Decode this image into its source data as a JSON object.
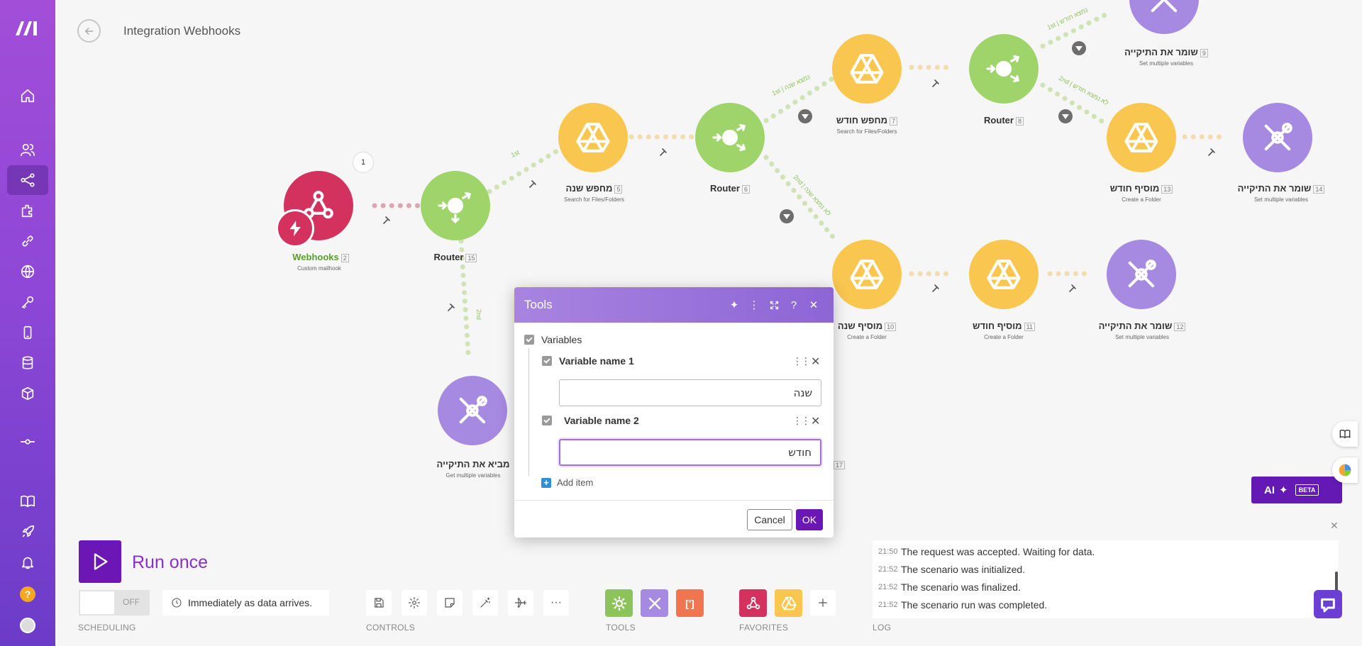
{
  "header": {
    "title": "Integration Webhooks"
  },
  "sidebar": {
    "items": [
      {
        "name": "home-icon"
      },
      {
        "name": "team-icon"
      },
      {
        "name": "scenarios-icon"
      },
      {
        "name": "templates-icon"
      },
      {
        "name": "connections-icon"
      },
      {
        "name": "webhooks-icon"
      },
      {
        "name": "keys-icon"
      },
      {
        "name": "devices-icon"
      },
      {
        "name": "datastores-icon"
      },
      {
        "name": "datastructures-icon"
      },
      {
        "name": "flow-icon"
      },
      {
        "name": "docs-icon"
      },
      {
        "name": "launch-icon"
      },
      {
        "name": "notifications-icon"
      }
    ],
    "help_label": "?"
  },
  "nodes": {
    "webhooks": {
      "title": "Webhooks",
      "num": "2",
      "sub": "Custom mailhook",
      "count": "1"
    },
    "router15": {
      "title": "Router",
      "num": "15"
    },
    "search_year": {
      "title": "מחפש שנה",
      "num": "5",
      "sub": "Search for Files/Folders"
    },
    "router6": {
      "title": "Router",
      "num": "6"
    },
    "search_month": {
      "title": "מחפש חודש",
      "num": "7",
      "sub": "Search for Files/Folders"
    },
    "router8": {
      "title": "Router",
      "num": "8"
    },
    "keeper9": {
      "title": "שומר את התיקייה",
      "num": "9",
      "sub": "Set multiple variables"
    },
    "add_month13": {
      "title": "מוסיף חודש",
      "num": "13",
      "sub": "Create a Folder"
    },
    "keeper14": {
      "title": "שומר את התיקייה",
      "num": "14",
      "sub": "Set multiple variables"
    },
    "add_year10": {
      "title": "מוסיף שנה",
      "num": "10",
      "sub": "Create a Folder"
    },
    "add_month11": {
      "title": "מוסיף חודש",
      "num": "11",
      "sub": "Create a Folder"
    },
    "keeper12": {
      "title": "שומר את התיקייה",
      "num": "12",
      "sub": "Set multiple variables"
    },
    "getter": {
      "title": "מביא את התיקייה",
      "sub": "Get multiple variables"
    },
    "hidden_num": "17"
  },
  "route_labels": {
    "r1": "1st",
    "r2": "2nd",
    "r6_1": "1st | נמצא שנה",
    "r6_2": "2nd | לא נמצא שנה",
    "r8_1": "1st | נמצא חודש",
    "r8_2": "2nd | לא נמצא חודש"
  },
  "modal": {
    "title": "Tools",
    "section": "Variables",
    "var1_label": "Variable name 1",
    "var1_value": "שנה",
    "var2_label": "Variable name 2",
    "var2_value": "חודש",
    "add_item": "Add item",
    "cancel": "Cancel",
    "ok": "OK"
  },
  "toolbar": {
    "run_label": "Run once",
    "toggle_text": "OFF",
    "schedule_text": "Immediately as data arrives.",
    "scheduling_label": "SCHEDULING",
    "controls_label": "CONTROLS",
    "tools_label": "TOOLS",
    "favorites_label": "FAVORITES",
    "log_label": "LOG",
    "more_label": "···",
    "brackets_label": "[']"
  },
  "log": [
    {
      "time": "21:50",
      "text": "The request was accepted. Waiting for data."
    },
    {
      "time": "21:52",
      "text": "The scenario was initialized."
    },
    {
      "time": "21:52",
      "text": "The scenario was finalized."
    },
    {
      "time": "21:52",
      "text": "The scenario run was completed."
    }
  ],
  "ai": {
    "label": "AI",
    "badge": "BETA"
  },
  "colors": {
    "sidebar": "#8e47d6",
    "webhook": "#d4325e",
    "router": "#9fd46a",
    "drive": "#f9c74f",
    "tools": "#a689e0",
    "accent": "#6b16b5"
  }
}
